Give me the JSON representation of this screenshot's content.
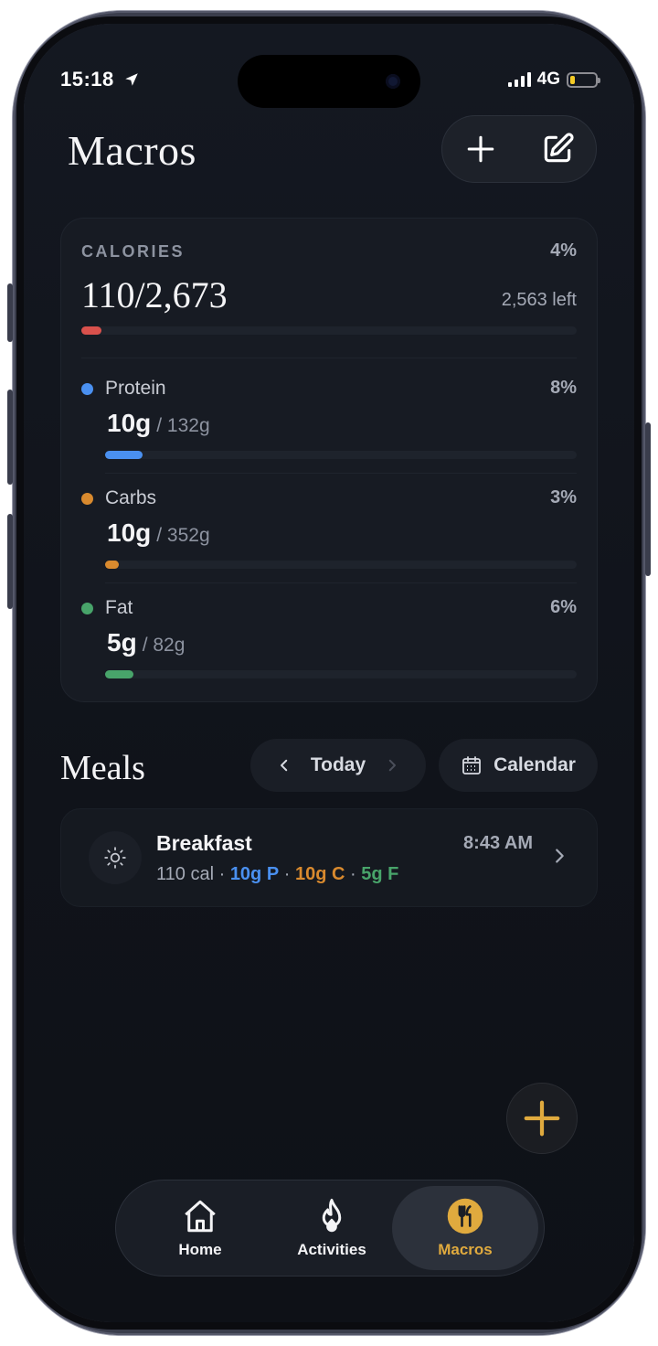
{
  "status_bar": {
    "time": "15:18",
    "network": "4G"
  },
  "header": {
    "title": "Macros"
  },
  "calories": {
    "label": "CALORIES",
    "percent_label": "4%",
    "value": "110/2,673",
    "left": "2,563 left",
    "progress": 0.04,
    "color": "#d9514c"
  },
  "macros": [
    {
      "name": "Protein",
      "percent_label": "8%",
      "value": "10g",
      "goal": "/ 132g",
      "progress": 0.08,
      "color": "#4a90f0"
    },
    {
      "name": "Carbs",
      "percent_label": "3%",
      "value": "10g",
      "goal": "/ 352g",
      "progress": 0.03,
      "color": "#d98a2e"
    },
    {
      "name": "Fat",
      "percent_label": "6%",
      "value": "5g",
      "goal": "/ 82g",
      "progress": 0.06,
      "color": "#48a46a"
    }
  ],
  "meals": {
    "title": "Meals",
    "day_label": "Today",
    "calendar_label": "Calendar",
    "items": [
      {
        "name": "Breakfast",
        "time": "8:43 AM",
        "calories": "110 cal",
        "sep": "·",
        "protein": "10g P",
        "carbs": "10g C",
        "fat": "5g F"
      }
    ]
  },
  "tabs": [
    {
      "label": "Home",
      "icon": "home-icon"
    },
    {
      "label": "Activities",
      "icon": "flame-icon"
    },
    {
      "label": "Macros",
      "icon": "utensils-icon",
      "active": true
    }
  ],
  "colors": {
    "accent": "#e0aa3e",
    "background": "#10131a",
    "card": "#171b23"
  }
}
